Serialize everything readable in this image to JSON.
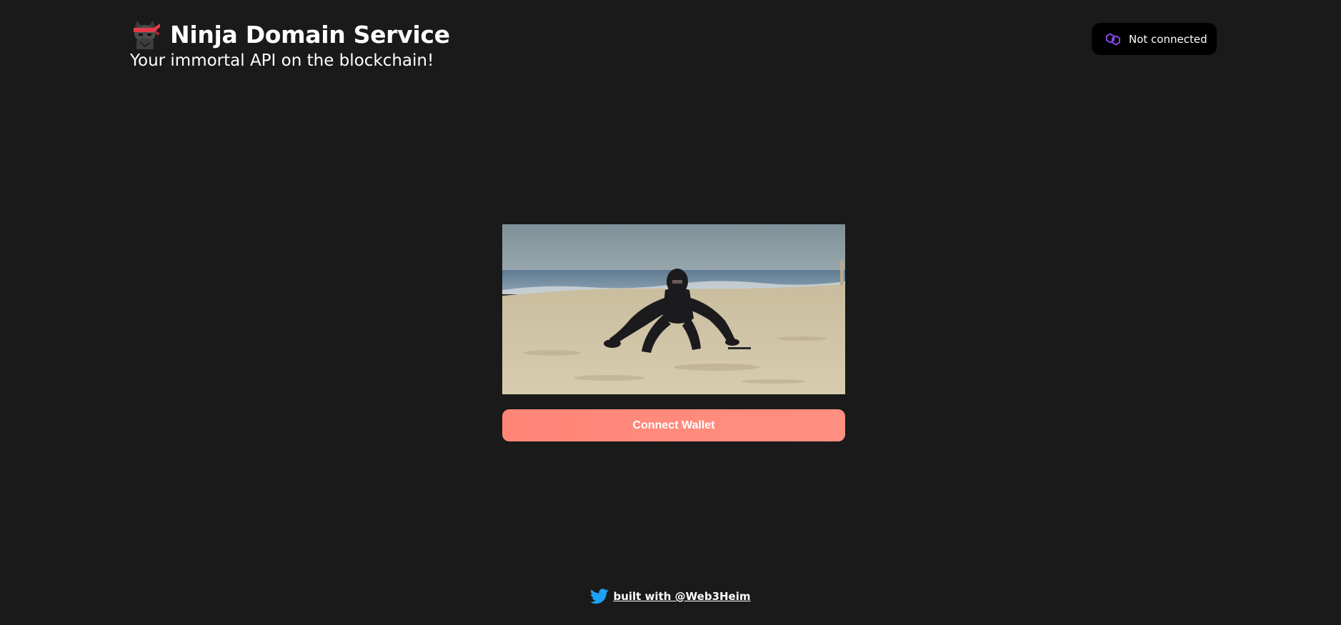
{
  "header": {
    "title": "Ninja Domain Service",
    "subtitle": "Your immortal API on the blockchain!",
    "logo_icon": "ninja-cat-icon"
  },
  "wallet_status": {
    "label": "Not connected",
    "icon": "polygon-chain-icon",
    "icon_color": "#8247e5"
  },
  "hero": {
    "icon": "ninja-on-beach-image"
  },
  "connect": {
    "label": "Connect Wallet",
    "color": "#ff8a7a"
  },
  "footer": {
    "link_label": "built with @Web3Heim",
    "icon": "twitter-icon",
    "icon_color": "#1da1f2"
  },
  "colors": {
    "background": "#1a1a1a",
    "text": "#ffffff"
  }
}
